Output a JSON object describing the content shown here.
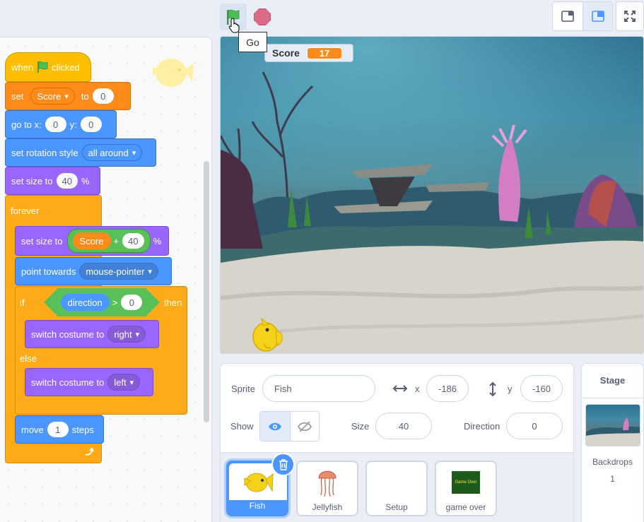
{
  "toolbar": {
    "go_tooltip": "Go"
  },
  "code": {
    "when_flag": {
      "when": "when",
      "clicked": "clicked"
    },
    "set_var": {
      "set": "set",
      "variable": "Score",
      "to": "to",
      "value": "0"
    },
    "goto": {
      "label": "go to x:",
      "x": "0",
      "y_label": "y:",
      "y": "0"
    },
    "rotation": {
      "label": "set rotation style",
      "value": "all around"
    },
    "size1": {
      "label": "set size to",
      "value": "40",
      "unit": "%"
    },
    "forever": "forever",
    "size2": {
      "label": "set size to",
      "reporter": "Score",
      "plus": "+",
      "value": "40",
      "unit": "%"
    },
    "point": {
      "label": "point towards",
      "value": "mouse-pointer"
    },
    "if_block": {
      "if": "if",
      "reporter": "direction",
      "gt": ">",
      "value": "0",
      "then": "then"
    },
    "costume_right": {
      "label": "switch costume to",
      "value": "right"
    },
    "else": "else",
    "costume_left": {
      "label": "switch costume to",
      "value": "left"
    },
    "move": {
      "label": "move",
      "value": "1",
      "unit": "steps"
    }
  },
  "stage": {
    "monitor_label": "Score",
    "monitor_value": "17"
  },
  "sprite_info": {
    "sprite_label": "Sprite",
    "sprite_name": "Fish",
    "x_label": "x",
    "x_value": "-186",
    "y_label": "y",
    "y_value": "-160",
    "show_label": "Show",
    "size_label": "Size",
    "size_value": "40",
    "direction_label": "Direction",
    "direction_value": "0"
  },
  "sprites": [
    {
      "name": "Fish"
    },
    {
      "name": "Jellyfish"
    },
    {
      "name": "Setup"
    },
    {
      "name": "game over",
      "thumb_text": "Game Over"
    }
  ],
  "stage_panel": {
    "title": "Stage",
    "backdrops_label": "Backdrops",
    "backdrops_count": "1"
  },
  "colors": {
    "motion": "#4c97ff",
    "looks": "#9966ff",
    "events": "#ffbf00",
    "control": "#ffab19",
    "variables": "#ff8c1a",
    "operators": "#59c059"
  }
}
